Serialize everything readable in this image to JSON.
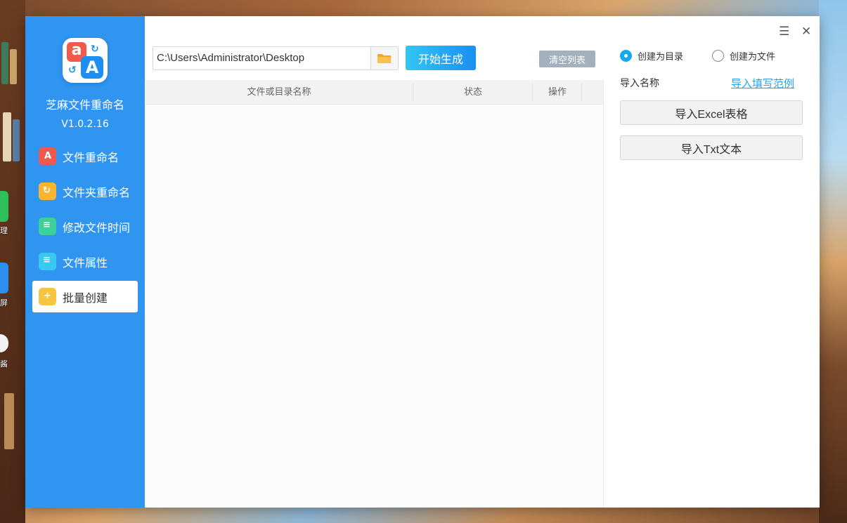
{
  "app": {
    "name": "芝麻文件重命名",
    "version": "V1.0.2.16"
  },
  "logo": {
    "letter_a": "a",
    "letter_b": "A"
  },
  "sidebar": {
    "items": [
      {
        "label": "文件重命名",
        "icon": "file-rename-icon",
        "color": "#ef5a4f",
        "active": false
      },
      {
        "label": "文件夹重命名",
        "icon": "folder-rename-icon",
        "color": "#f7b531",
        "active": false
      },
      {
        "label": "修改文件时间",
        "icon": "file-time-icon",
        "color": "#3dd19a",
        "active": false
      },
      {
        "label": "文件属性",
        "icon": "file-attribute-icon",
        "color": "#38c9f0",
        "active": false
      },
      {
        "label": "批量创建",
        "icon": "batch-create-icon",
        "color": "#f7c443",
        "active": true
      }
    ]
  },
  "toolbar": {
    "path_value": "C:\\Users\\Administrator\\Desktop",
    "start_label": "开始生成",
    "clear_label": "清空列表"
  },
  "table": {
    "columns": [
      "文件或目录名称",
      "状态",
      "操作"
    ],
    "rows": []
  },
  "options": {
    "create_dir_label": "创建为目录",
    "create_file_label": "创建为文件",
    "selected": "create_dir"
  },
  "import": {
    "title": "导入名称",
    "example_link": "导入填写范例",
    "excel_label": "导入Excel表格",
    "txt_label": "导入Txt文本"
  },
  "window": {
    "menu_icon": "menu-icon",
    "close_icon": "close-icon"
  },
  "desktop": {
    "labels": [
      "理",
      "屏",
      "酱"
    ]
  },
  "colors": {
    "sidebar": "#2f95f0",
    "accent": "#17a9f0",
    "start_button_from": "#33c5f3",
    "start_button_to": "#1a8ff2"
  }
}
